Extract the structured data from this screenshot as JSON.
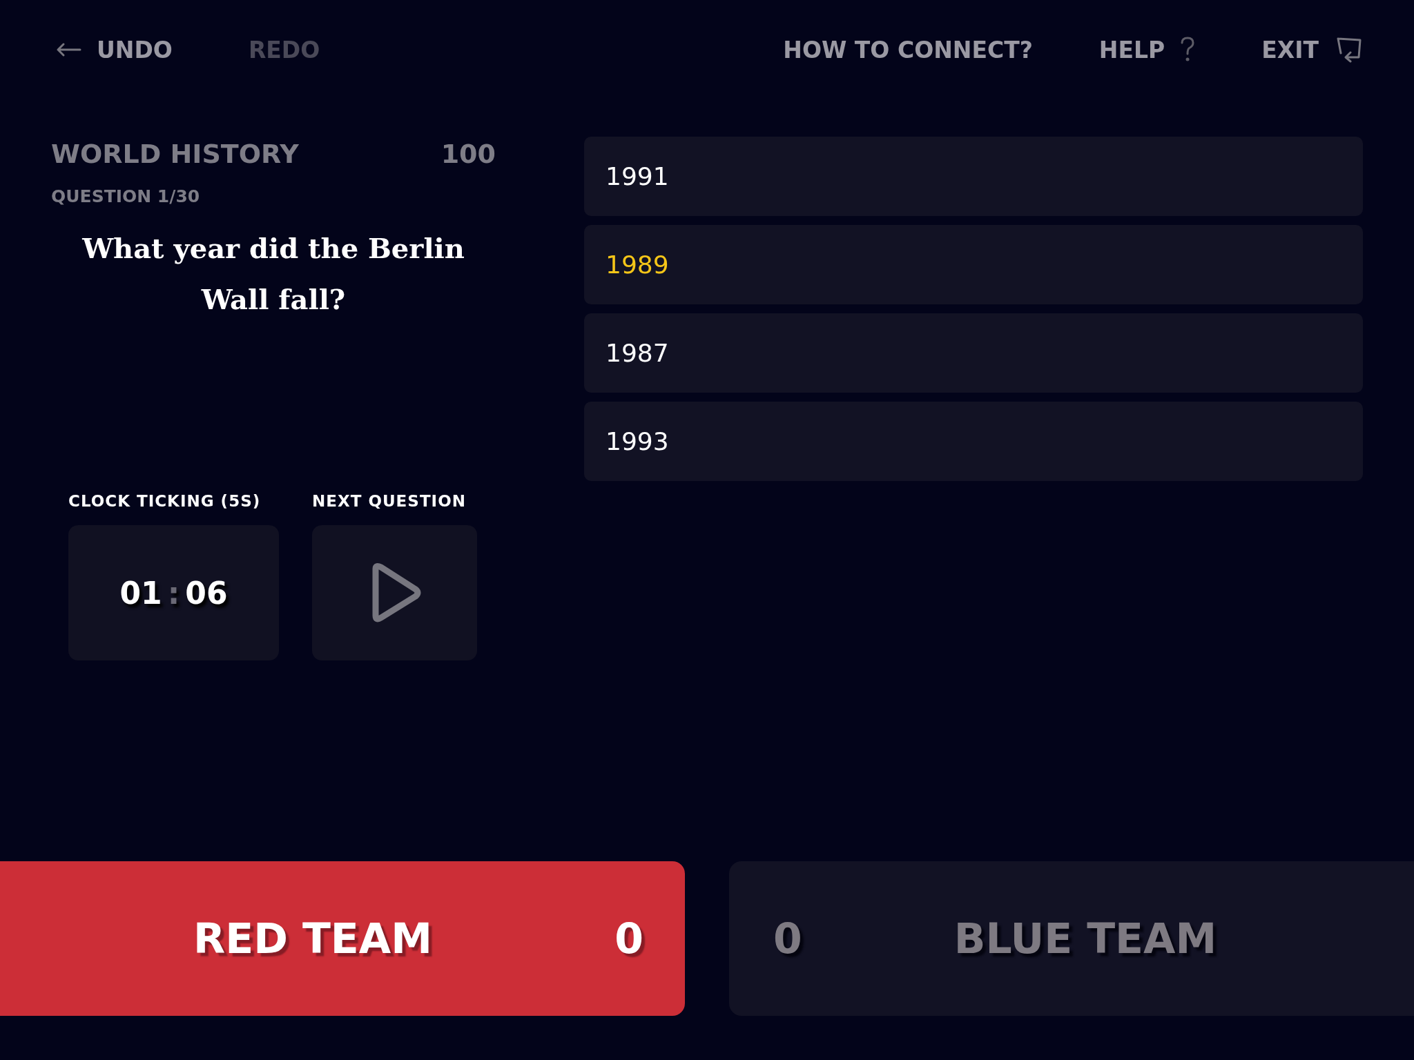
{
  "toolbar": {
    "undo": {
      "label": "UNDO",
      "disabled": false
    },
    "redo": {
      "label": "REDO",
      "disabled": true
    },
    "links": [
      {
        "label": "HOW TO CONNECT?",
        "kind": "text"
      },
      {
        "label": "HELP",
        "kind": "help"
      },
      {
        "label": "EXIT",
        "kind": "exit"
      }
    ]
  },
  "question": {
    "category": "WORLD HISTORY",
    "points": "100",
    "progress": "QUESTION 1/30",
    "text": "What year did the Berlin Wall fall?"
  },
  "answers": [
    {
      "label": "1991",
      "selected": false
    },
    {
      "label": "1989",
      "selected": true
    },
    {
      "label": "1987",
      "selected": false
    },
    {
      "label": "1993",
      "selected": false
    }
  ],
  "timer": {
    "label": "CLOCK TICKING (5S)",
    "minutes": "01",
    "separator": ":",
    "seconds": "06"
  },
  "next": {
    "label": "NEXT QUESTION"
  },
  "teams": [
    {
      "name": "RED TEAM",
      "score": "0",
      "selected": true
    },
    {
      "name": "BLUE TEAM",
      "score": "0",
      "selected": false
    }
  ]
}
